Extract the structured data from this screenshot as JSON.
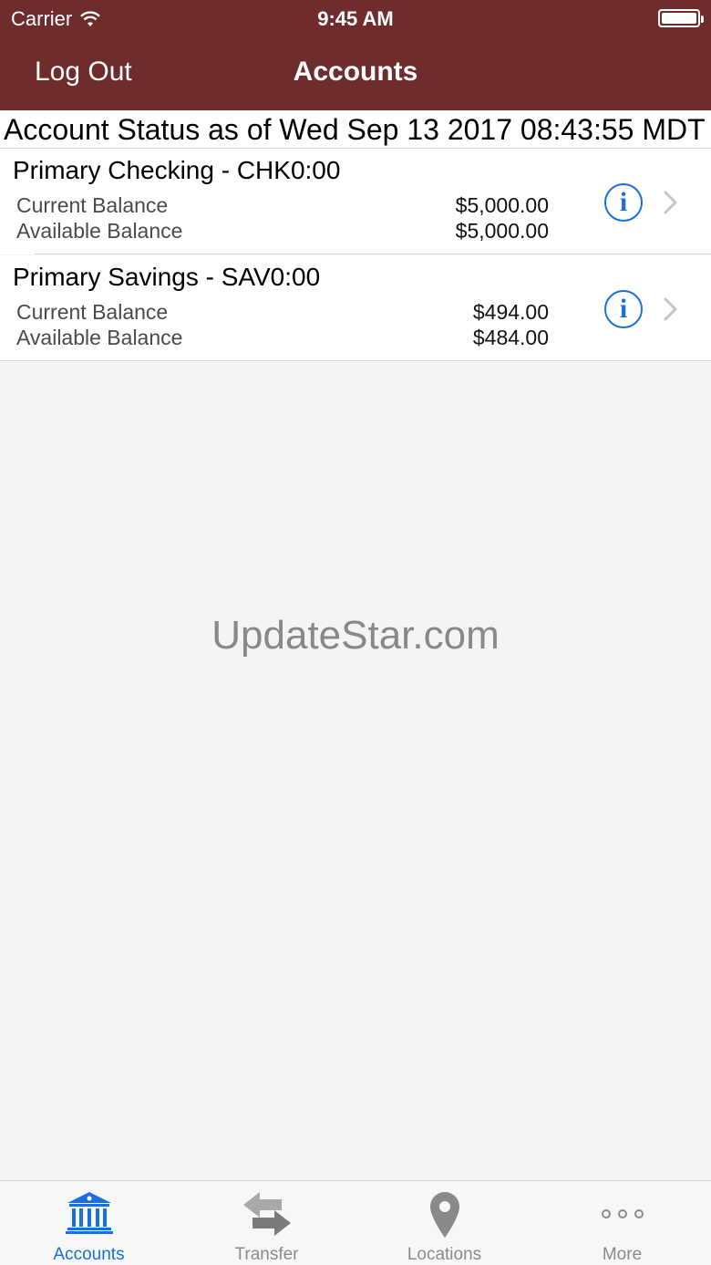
{
  "status_bar": {
    "carrier": "Carrier",
    "time": "9:45 AM"
  },
  "nav": {
    "left_button": "Log Out",
    "title": "Accounts"
  },
  "status_line": "Account Status as of Wed Sep 13 2017 08:43:55 MDT",
  "accounts": [
    {
      "name": "Primary Checking - CHK0:00",
      "current_label": "Current Balance",
      "current_value": "$5,000.00",
      "available_label": "Available Balance",
      "available_value": "$5,000.00"
    },
    {
      "name": "Primary Savings - SAV0:00",
      "current_label": "Current Balance",
      "current_value": "$494.00",
      "available_label": "Available Balance",
      "available_value": "$484.00"
    }
  ],
  "watermark": "UpdateStar.com",
  "tabs": [
    {
      "label": "Accounts",
      "icon": "bank-icon",
      "active": true
    },
    {
      "label": "Transfer",
      "icon": "transfer-arrows-icon",
      "active": false
    },
    {
      "label": "Locations",
      "icon": "location-pin-icon",
      "active": false
    },
    {
      "label": "More",
      "icon": "more-dots-icon",
      "active": false
    }
  ],
  "colors": {
    "header": "#6f2c2c",
    "accent": "#1a6fe0",
    "background": "#f4f4f4"
  }
}
